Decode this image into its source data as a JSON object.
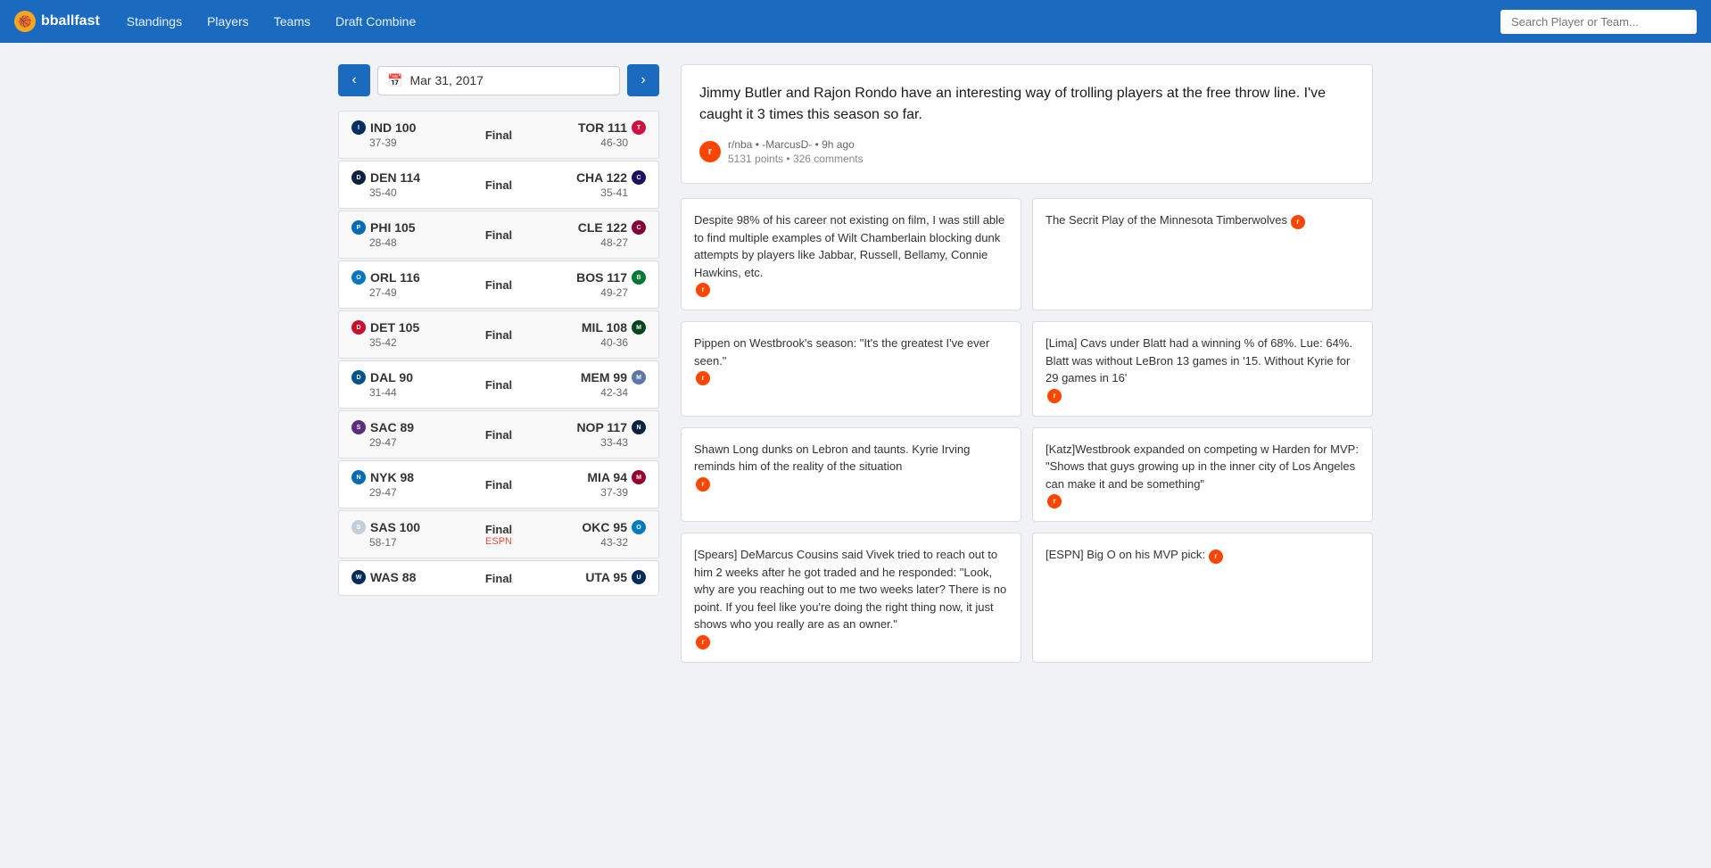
{
  "navbar": {
    "brand": "bballfast",
    "links": [
      "Standings",
      "Players",
      "Teams",
      "Draft Combine"
    ],
    "search_placeholder": "Search Player or Team..."
  },
  "date_nav": {
    "date": "Mar 31, 2017"
  },
  "games": [
    {
      "away_team": "IND",
      "away_score": 100,
      "away_record": "37-39",
      "status": "Final",
      "status_sub": "",
      "home_team": "TOR",
      "home_score": 111,
      "home_record": "46-30",
      "away_logo_class": "logo-ind",
      "home_logo_class": "logo-tor"
    },
    {
      "away_team": "DEN",
      "away_score": 114,
      "away_record": "35-40",
      "status": "Final",
      "status_sub": "",
      "home_team": "CHA",
      "home_score": 122,
      "home_record": "35-41",
      "away_logo_class": "logo-den",
      "home_logo_class": "logo-cha"
    },
    {
      "away_team": "PHI",
      "away_score": 105,
      "away_record": "28-48",
      "status": "Final",
      "status_sub": "",
      "home_team": "CLE",
      "home_score": 122,
      "home_record": "48-27",
      "away_logo_class": "logo-phi",
      "home_logo_class": "logo-cle"
    },
    {
      "away_team": "ORL",
      "away_score": 116,
      "away_record": "27-49",
      "status": "Final",
      "status_sub": "",
      "home_team": "BOS",
      "home_score": 117,
      "home_record": "49-27",
      "away_logo_class": "logo-orl",
      "home_logo_class": "logo-bos"
    },
    {
      "away_team": "DET",
      "away_score": 105,
      "away_record": "35-42",
      "status": "Final",
      "status_sub": "",
      "home_team": "MIL",
      "home_score": 108,
      "home_record": "40-36",
      "away_logo_class": "logo-det",
      "home_logo_class": "logo-mil"
    },
    {
      "away_team": "DAL",
      "away_score": 90,
      "away_record": "31-44",
      "status": "Final",
      "status_sub": "",
      "home_team": "MEM",
      "home_score": 99,
      "home_record": "42-34",
      "away_logo_class": "logo-dal",
      "home_logo_class": "logo-mem"
    },
    {
      "away_team": "SAC",
      "away_score": 89,
      "away_record": "29-47",
      "status": "Final",
      "status_sub": "",
      "home_team": "NOP",
      "home_score": 117,
      "home_record": "33-43",
      "away_logo_class": "logo-sac",
      "home_logo_class": "logo-nop"
    },
    {
      "away_team": "NYK",
      "away_score": 98,
      "away_record": "29-47",
      "status": "Final",
      "status_sub": "",
      "home_team": "MIA",
      "home_score": 94,
      "home_record": "37-39",
      "away_logo_class": "logo-nyk",
      "home_logo_class": "logo-mia"
    },
    {
      "away_team": "SAS",
      "away_score": 100,
      "away_record": "58-17",
      "status": "Final",
      "status_sub": "ESPN",
      "home_team": "OKC",
      "home_score": 95,
      "home_record": "43-32",
      "away_logo_class": "logo-sas",
      "home_logo_class": "logo-okc"
    },
    {
      "away_team": "WAS",
      "away_score": 88,
      "away_record": "",
      "status": "Final",
      "status_sub": "",
      "home_team": "UTA",
      "home_score": 95,
      "home_record": "",
      "away_logo_class": "logo-was",
      "home_logo_class": "logo-uta"
    }
  ],
  "featured_post": {
    "text": "Jimmy Butler and Rajon Rondo have an interesting way of trolling players at the free throw line. I've caught it 3 times this season so far.",
    "subreddit": "r/nba",
    "author": "-MarcusD-",
    "time": "9h ago",
    "points": "5131 points",
    "comments": "326 comments"
  },
  "news_cards": [
    {
      "text": "Despite 98% of his career not existing on film, I was still able to find multiple examples of Wilt Chamberlain blocking dunk attempts by players like Jabbar, Russell, Bellamy, Connie Hawkins, etc.",
      "has_reddit": true
    },
    {
      "text": "The Secrit Play of the Minnesota Timberwolves",
      "has_reddit": true
    },
    {
      "text": "Pippen on Westbrook's season: \"It's the greatest I've ever seen.\"",
      "has_reddit": true
    },
    {
      "text": "[Lima] Cavs under Blatt had a winning % of 68%. Lue: 64%. Blatt was without LeBron 13 games in '15. Without Kyrie for 29 games in 16'",
      "has_reddit": true
    },
    {
      "text": "Shawn Long dunks on Lebron and taunts. Kyrie Irving reminds him of the reality of the situation",
      "has_reddit": true
    },
    {
      "text": "[Katz]Westbrook expanded on competing w Harden for MVP: \"Shows that guys growing up in the inner city of Los Angeles can make it and be something\"",
      "has_reddit": true
    },
    {
      "text": "[Spears] DeMarcus Cousins said Vivek tried to reach out to him 2 weeks after he got traded and he responded: \"Look, why are you reaching out to me two weeks later? There is no point. If you feel like you're doing the right thing now, it just shows who you really are as an owner.\"",
      "has_reddit": true
    },
    {
      "text": "[ESPN] Big O on his MVP pick:",
      "has_reddit": true
    }
  ]
}
